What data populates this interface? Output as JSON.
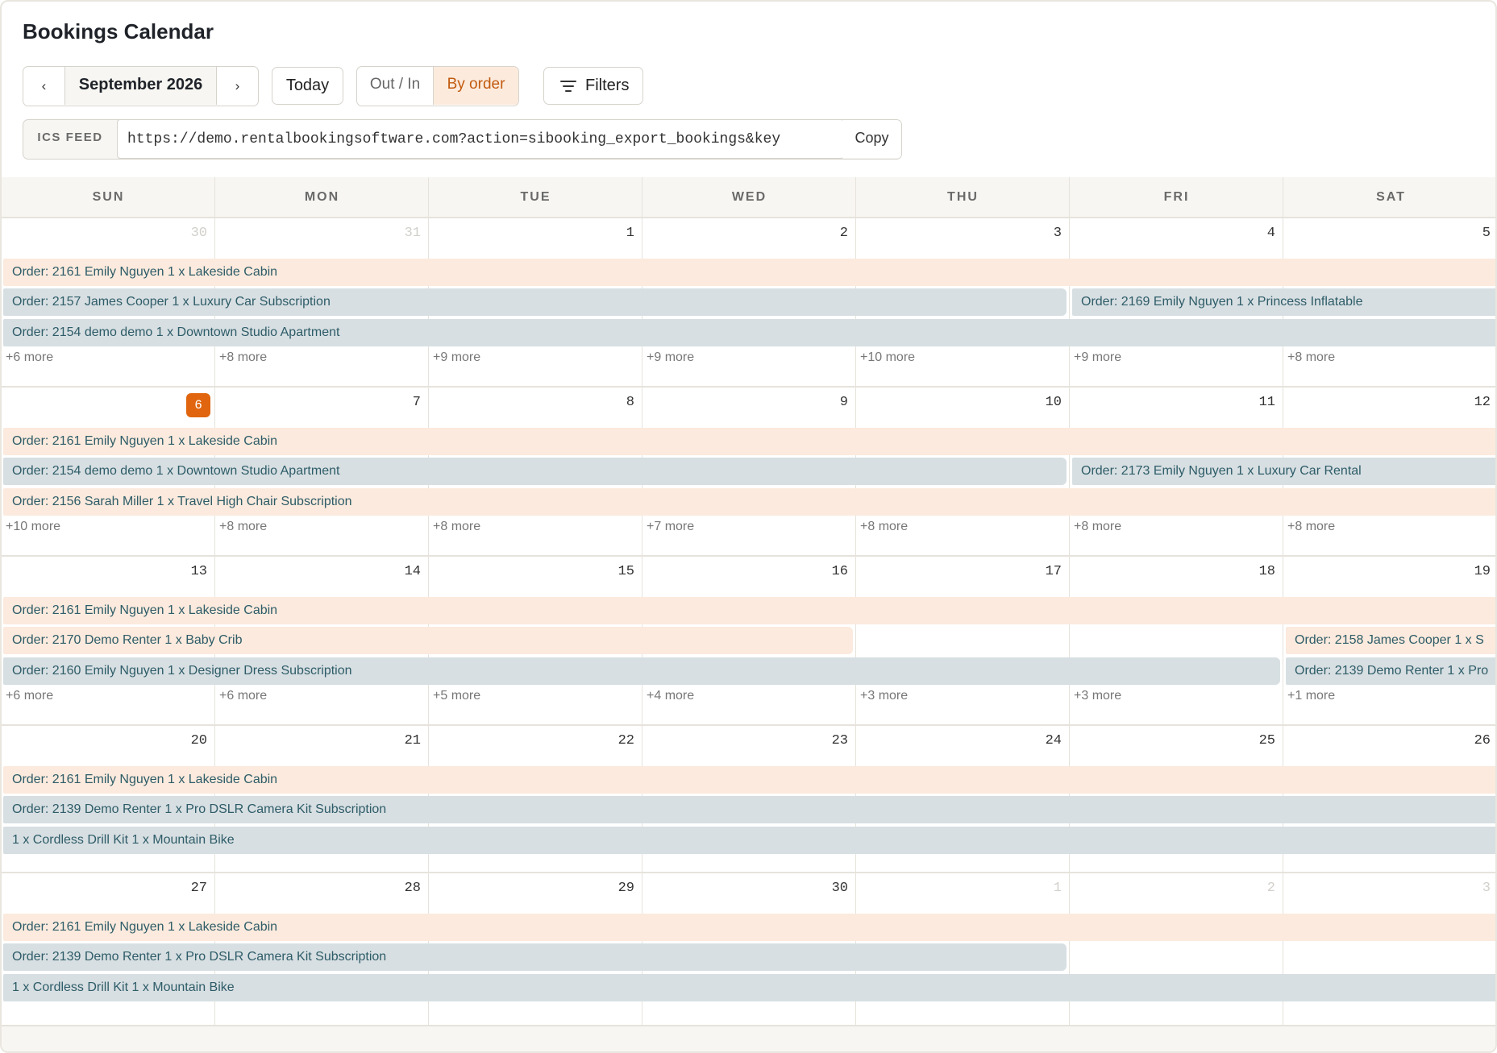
{
  "title": "Bookings Calendar",
  "toolbar": {
    "prev_label": "‹",
    "month_label": "September 2026",
    "next_label": "›",
    "today_label": "Today",
    "view_options": [
      "Out / In",
      "By order"
    ],
    "active_view": "By order",
    "filters_label": "Filters",
    "filters_icon": "filter-lines-icon"
  },
  "ics": {
    "label": "ICS FEED",
    "url": "https://demo.rentalbookingsoftware.com?action=sibooking_export_bookings&key",
    "copy_label": "Copy"
  },
  "colors": {
    "accent": "#e0650e",
    "accent_text": "#c25a10",
    "event_peach": "#fbeadd",
    "event_gray": "#d7dfe2",
    "event_text": "#2e5c68"
  },
  "weekdays": [
    "SUN",
    "MON",
    "TUE",
    "WED",
    "THU",
    "FRI",
    "SAT"
  ],
  "today": 6,
  "weeks": [
    {
      "days": [
        {
          "num": "30",
          "muted": true
        },
        {
          "num": "31",
          "muted": true
        },
        {
          "num": "1"
        },
        {
          "num": "2"
        },
        {
          "num": "3"
        },
        {
          "num": "4"
        },
        {
          "num": "5"
        }
      ],
      "events": [
        {
          "text": "Order: 2161 Emily Nguyen 1 x Lakeside Cabin",
          "color": "peach",
          "start": 0,
          "end": 6,
          "lane": 0
        },
        {
          "text": "Order: 2157 James Cooper 1 x Luxury Car Subscription",
          "color": "gray",
          "start": 0,
          "end": 4,
          "lane": 1
        },
        {
          "text": "Order: 2169 Emily Nguyen 1 x Princess Inflatable",
          "color": "gray",
          "start": 5,
          "end": 6,
          "lane": 1
        },
        {
          "text": "Order: 2154 demo demo 1 x Downtown Studio Apartment",
          "color": "gray",
          "start": 0,
          "end": 6,
          "lane": 2
        }
      ],
      "more": [
        "+6 more",
        "+8 more",
        "+9 more",
        "+9 more",
        "+10 more",
        "+9 more",
        "+8 more"
      ]
    },
    {
      "days": [
        {
          "num": "6",
          "today": true
        },
        {
          "num": "7"
        },
        {
          "num": "8"
        },
        {
          "num": "9"
        },
        {
          "num": "10"
        },
        {
          "num": "11"
        },
        {
          "num": "12"
        }
      ],
      "events": [
        {
          "text": "Order: 2161 Emily Nguyen 1 x Lakeside Cabin",
          "color": "peach",
          "start": 0,
          "end": 6,
          "lane": 0
        },
        {
          "text": "Order: 2154 demo demo 1 x Downtown Studio Apartment",
          "color": "gray",
          "start": 0,
          "end": 4,
          "lane": 1
        },
        {
          "text": "Order: 2173 Emily Nguyen 1 x Luxury Car Rental",
          "color": "gray",
          "start": 5,
          "end": 6,
          "lane": 1
        },
        {
          "text": "Order: 2156 Sarah Miller 1 x Travel High Chair Subscription",
          "color": "peach",
          "start": 0,
          "end": 6,
          "lane": 2
        }
      ],
      "more": [
        "+10 more",
        "+8 more",
        "+8 more",
        "+7 more",
        "+8 more",
        "+8 more",
        "+8 more"
      ]
    },
    {
      "days": [
        {
          "num": "13"
        },
        {
          "num": "14"
        },
        {
          "num": "15"
        },
        {
          "num": "16"
        },
        {
          "num": "17"
        },
        {
          "num": "18"
        },
        {
          "num": "19"
        }
      ],
      "events": [
        {
          "text": "Order: 2161 Emily Nguyen 1 x Lakeside Cabin",
          "color": "peach",
          "start": 0,
          "end": 6,
          "lane": 0
        },
        {
          "text": "Order: 2170 Demo Renter 1 x Baby Crib",
          "color": "peach",
          "start": 0,
          "end": 3,
          "lane": 1
        },
        {
          "text": "Order: 2158 James Cooper 1 x S",
          "color": "peach",
          "start": 6,
          "end": 6,
          "lane": 1
        },
        {
          "text": "Order: 2160 Emily Nguyen 1 x Designer Dress Subscription",
          "color": "gray",
          "start": 0,
          "end": 5,
          "lane": 2
        },
        {
          "text": "Order: 2139 Demo Renter 1 x Pro",
          "color": "gray",
          "start": 6,
          "end": 6,
          "lane": 2
        }
      ],
      "more": [
        "+6 more",
        "+6 more",
        "+5 more",
        "+4 more",
        "+3 more",
        "+3 more",
        "+1 more"
      ]
    },
    {
      "days": [
        {
          "num": "20"
        },
        {
          "num": "21"
        },
        {
          "num": "22"
        },
        {
          "num": "23"
        },
        {
          "num": "24"
        },
        {
          "num": "25"
        },
        {
          "num": "26"
        }
      ],
      "events": [
        {
          "text": "Order: 2161 Emily Nguyen 1 x Lakeside Cabin",
          "color": "peach",
          "start": 0,
          "end": 6,
          "lane": 0
        },
        {
          "text": "Order: 2139 Demo Renter 1 x Pro DSLR Camera Kit Subscription",
          "color": "gray",
          "start": 0,
          "end": 6,
          "lane": 1
        },
        {
          "text": "1 x Cordless Drill Kit 1 x Mountain Bike",
          "color": "gray",
          "start": 0,
          "end": 6,
          "lane": 2
        }
      ],
      "more": []
    },
    {
      "days": [
        {
          "num": "27"
        },
        {
          "num": "28"
        },
        {
          "num": "29"
        },
        {
          "num": "30"
        },
        {
          "num": "1",
          "muted": true
        },
        {
          "num": "2",
          "muted": true
        },
        {
          "num": "3",
          "muted": true
        }
      ],
      "events": [
        {
          "text": "Order: 2161 Emily Nguyen 1 x Lakeside Cabin",
          "color": "peach",
          "start": 0,
          "end": 6,
          "lane": 0
        },
        {
          "text": "Order: 2139 Demo Renter 1 x Pro DSLR Camera Kit Subscription",
          "color": "gray",
          "start": 0,
          "end": 4,
          "lane": 1
        },
        {
          "text": "1 x Cordless Drill Kit 1 x Mountain Bike",
          "color": "gray",
          "start": 0,
          "end": 6,
          "lane": 2
        }
      ],
      "more": []
    }
  ]
}
